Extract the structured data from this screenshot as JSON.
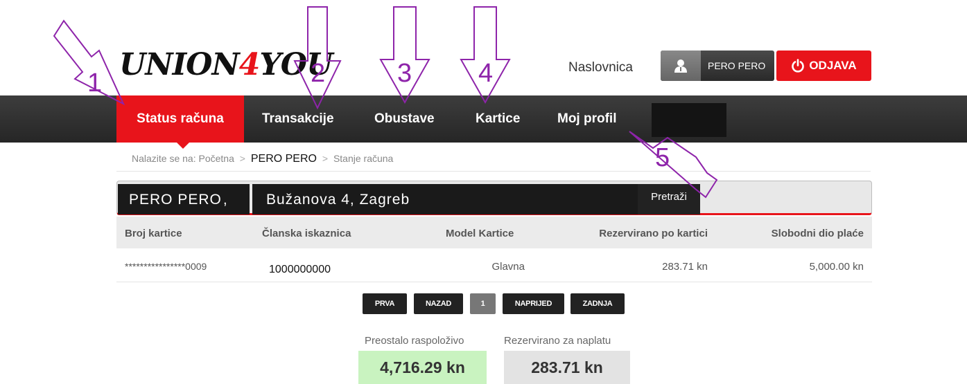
{
  "header": {
    "logo_prefix": "UNION",
    "logo_four": "4",
    "logo_suffix": "YOU",
    "home_link": "Naslovnica",
    "user_name": "PERO PERO",
    "logout_label": "ODJAVA"
  },
  "nav": {
    "items": [
      {
        "label": "Status računa",
        "active": true
      },
      {
        "label": "Transakcije"
      },
      {
        "label": "Obustave"
      },
      {
        "label": "Kartice"
      },
      {
        "label": "Moj profil"
      }
    ]
  },
  "breadcrumb": {
    "prefix": "Nalazite se na:",
    "home": "Početna",
    "separator": ">",
    "user": "PERO PERO",
    "current": "Stanje računa"
  },
  "search": {
    "name": "PERO PERO",
    "name_suffix": ",",
    "address": "Bužanova 4, Zagreb",
    "button": "Pretraži"
  },
  "table": {
    "headers": [
      "Broj kartice",
      "Članska iskaznica",
      "Model Kartice",
      "Rezervirano po kartici",
      "Slobodni dio plaće"
    ],
    "rows": [
      [
        "****************0009",
        "1000000000",
        "Glavna",
        "283.71 kn",
        "5,000.00 kn"
      ]
    ]
  },
  "pagination": {
    "first": "PRVA",
    "prev": "NAZAD",
    "current": "1",
    "next": "NAPRIJED",
    "last": "ZADNJA"
  },
  "balances": {
    "available_label": "Preostalo raspoloživo",
    "available_value": "4,716.29 kn",
    "reserved_label": "Rezervirano za naplatu",
    "reserved_value": "283.71 kn"
  },
  "annotations": [
    "1",
    "2",
    "3",
    "4",
    "5"
  ],
  "colors": {
    "brand_red": "#e8141b",
    "nav_dark": "#2f2f2f",
    "annotation_purple": "#8e24aa",
    "available_green": "#c9f3c0"
  }
}
